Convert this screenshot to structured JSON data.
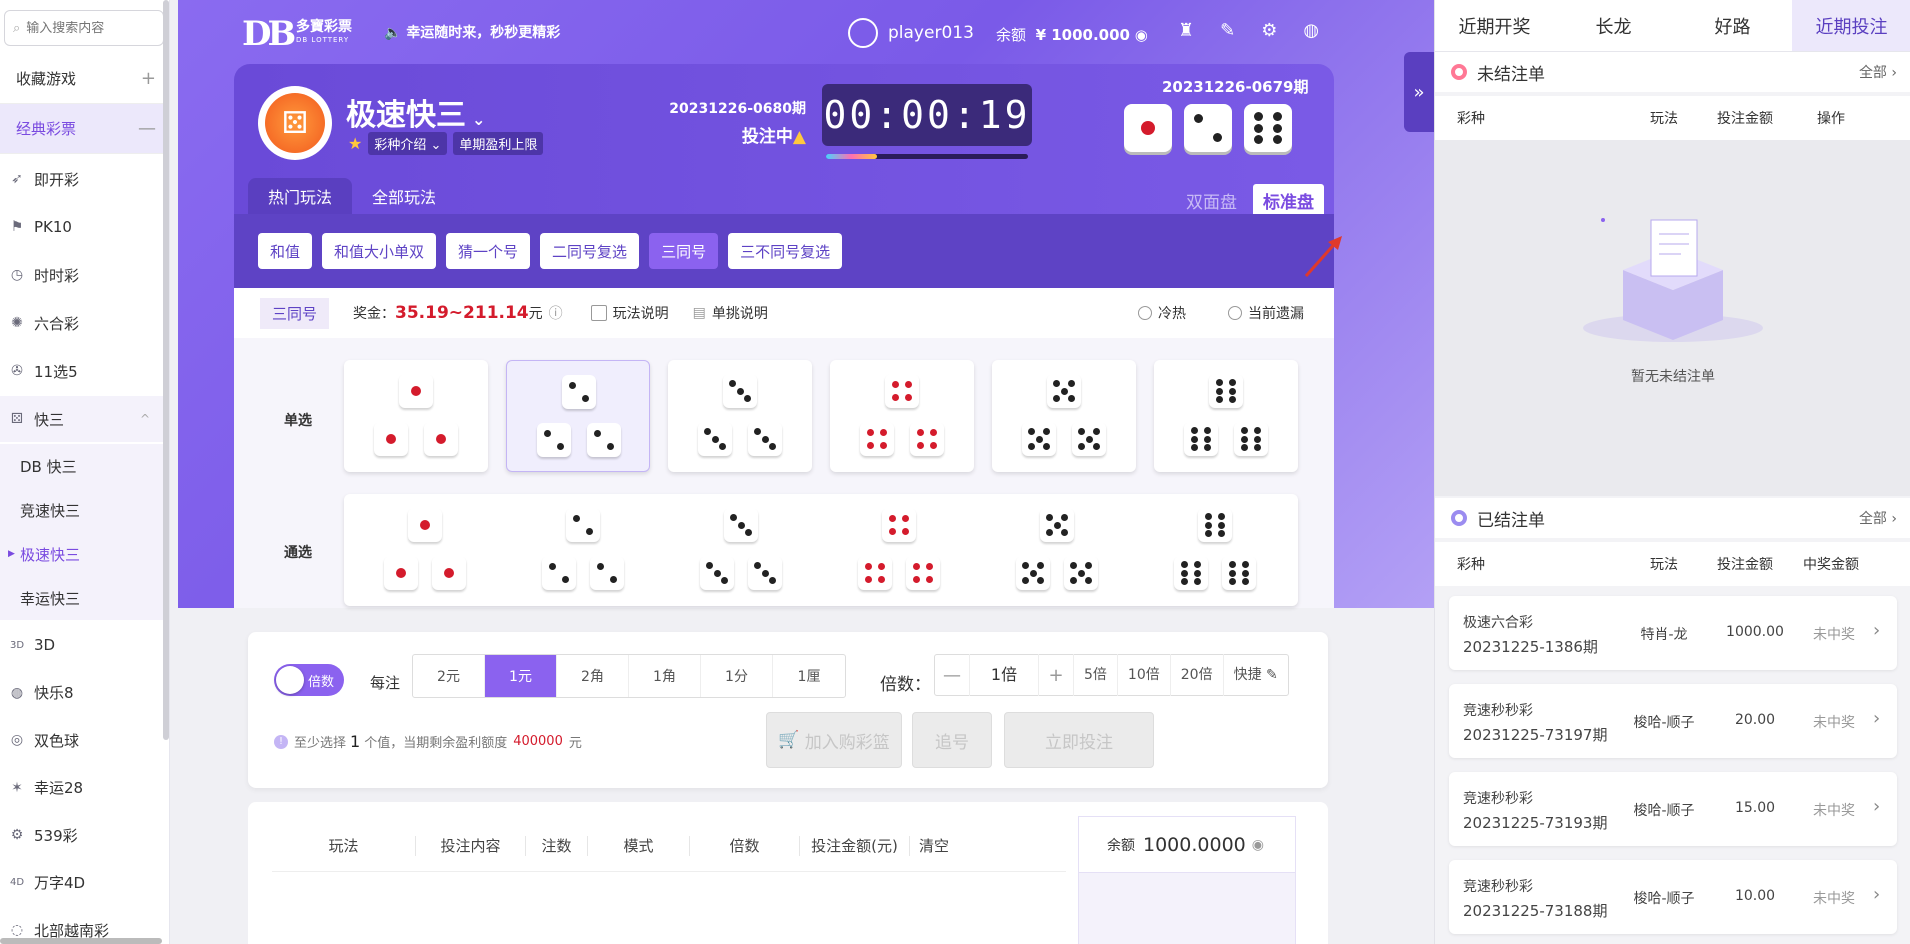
{
  "sidebar": {
    "search_placeholder": "输入搜索内容",
    "favorites": "收藏游戏",
    "favorites_sign": "+",
    "classic": "经典彩票",
    "classic_sign": "—",
    "items": [
      {
        "label": "即开彩",
        "icon": "rocket-icon"
      },
      {
        "label": "PK10",
        "icon": "flag-icon"
      },
      {
        "label": "时时彩",
        "icon": "clock-icon"
      },
      {
        "label": "六合彩",
        "icon": "sun-icon"
      },
      {
        "label": "11选5",
        "icon": "pinwheel-icon"
      },
      {
        "label": "快三",
        "icon": "dice-icon"
      }
    ],
    "k3_sign": "^",
    "k3_subs": [
      "DB 快三",
      "竞速快三",
      "极速快三",
      "幸运快三"
    ],
    "k3_active": "极速快三",
    "more": [
      {
        "label": "3D",
        "icon": "3d-icon"
      },
      {
        "label": "快乐8",
        "icon": "circle-icon"
      },
      {
        "label": "双色球",
        "icon": "ball-icon"
      },
      {
        "label": "幸运28",
        "icon": "star-icon"
      },
      {
        "label": "539彩",
        "icon": "gear-icon"
      },
      {
        "label": "万字4D",
        "icon": "4d-icon"
      },
      {
        "label": "北部越南彩",
        "icon": "globe-icon"
      }
    ]
  },
  "header": {
    "logo": "DB",
    "brand": "多寶彩票",
    "brand_en": "DB LOTTERY",
    "slogan": "幸运随时来，秒秒更精彩",
    "username": "player013",
    "balance_label": "余额",
    "balance": "¥ 1000.000"
  },
  "game": {
    "name": "极速快三",
    "intro": "彩种介绍",
    "limit": "单期盈利上限",
    "current_period": "20231226-0680期",
    "status": "投注中",
    "countdown": "00:00:19",
    "countdown_progress": 0.25,
    "last_period": "20231226-0679期",
    "last_dice": [
      1,
      2,
      6
    ],
    "tabs": [
      "热门玩法",
      "全部玩法"
    ],
    "modes": [
      "双面盘",
      "标准盘"
    ],
    "subtabs": [
      "和值",
      "和值大小单双",
      "猜一个号",
      "二同号复选",
      "三同号",
      "三不同号复选"
    ],
    "active_subtab": "三同号"
  },
  "info": {
    "play": "三同号",
    "prize_label": "奖金：",
    "prize": "35.19~211.14",
    "prize_unit": "元",
    "rules": "玩法说明",
    "single": "单挑说明",
    "hot": "冷热",
    "miss": "当前遗漏"
  },
  "pick": {
    "single_label": "单选",
    "all_label": "通选",
    "faces": [
      1,
      2,
      3,
      4,
      5,
      6
    ],
    "selected_face": 2
  },
  "bet": {
    "toggle": "倍数",
    "unit_label": "每注",
    "units": [
      "2元",
      "1元",
      "2角",
      "1角",
      "1分",
      "1厘"
    ],
    "active_unit": "1元",
    "mult_label": "倍数：",
    "mult_minus": "—",
    "mult_plus": "+",
    "mult_value": "1倍",
    "quick": [
      "5倍",
      "10倍",
      "20倍",
      "快捷"
    ],
    "hint_a": "至少选择",
    "hint_n": "1",
    "hint_b": "个值，当期剩余盈利额度",
    "hint_amount": "400000",
    "hint_unit": "元",
    "btn_cart": "加入购彩篮",
    "btn_chase": "追号",
    "btn_submit": "立即投注"
  },
  "cart": {
    "cols": [
      "玩法",
      "投注内容",
      "注数",
      "模式",
      "倍数",
      "投注金额(元)",
      "清空"
    ],
    "balance_label": "余额",
    "balance": "1000.0000"
  },
  "right": {
    "tabs": [
      "近期开奖",
      "长龙",
      "好路",
      "近期投注"
    ],
    "active_tab": "近期投注",
    "open_title": "未结注单",
    "all": "全部",
    "open_cols": [
      "彩种",
      "玩法",
      "投注金额",
      "操作"
    ],
    "empty": "暂无未结注单",
    "settled_title": "已结注单",
    "settled_cols": [
      "彩种",
      "玩法",
      "投注金额",
      "中奖金额"
    ],
    "settled": [
      {
        "name": "极速六合彩",
        "period": "20231225-1386期",
        "play": "特肖-龙",
        "amount": "1000.00",
        "status": "未中奖"
      },
      {
        "name": "竞速秒秒彩",
        "period": "20231225-73197期",
        "play": "梭哈-顺子",
        "amount": "20.00",
        "status": "未中奖"
      },
      {
        "name": "竞速秒秒彩",
        "period": "20231225-73193期",
        "play": "梭哈-顺子",
        "amount": "15.00",
        "status": "未中奖"
      },
      {
        "name": "竞速秒秒彩",
        "period": "20231225-73188期",
        "play": "梭哈-顺子",
        "amount": "10.00",
        "status": "未中奖"
      }
    ]
  }
}
